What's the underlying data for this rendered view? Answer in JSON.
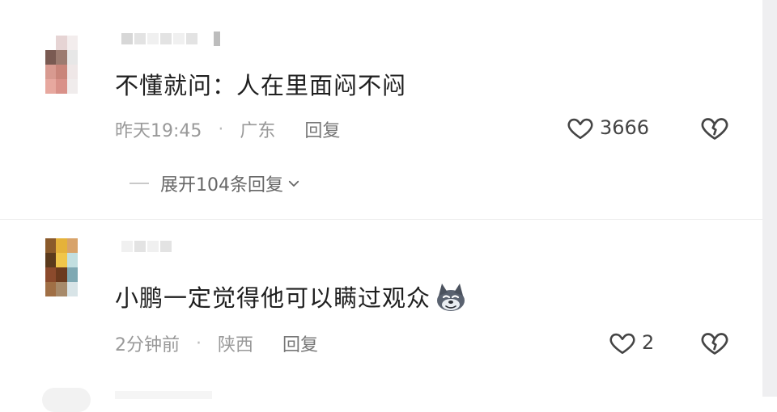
{
  "comments": [
    {
      "text": "不懂就问：人在里面闷不闷",
      "time": "昨天19:45",
      "location": "广东",
      "reply_label": "回复",
      "like_count": "3666",
      "expand_label": "展开104条回复",
      "avatar_colors": [
        "#ffffff",
        "#e6d4d4",
        "#f3eded",
        "#7a5a52",
        "#9c7b70",
        "#e7e7e7",
        "#d89a90",
        "#c9857a",
        "#efe7e7",
        "#e7a89f",
        "#d99189",
        "#f0ecec"
      ]
    },
    {
      "text": "小鹏一定觉得他可以瞒过观众",
      "time": "2分钟前",
      "location": "陕西",
      "reply_label": "回复",
      "like_count": "2",
      "avatar_colors": [
        "#8a5a2b",
        "#e5b23a",
        "#d8a36a",
        "#5b3a1c",
        "#f0c64a",
        "#c2dfe0",
        "#8b4a2c",
        "#6b3a1e",
        "#7fa9b3",
        "#a06f45",
        "#a78a6a",
        "#d8e4e7"
      ]
    }
  ],
  "icons": {
    "like": "heart-outline-icon",
    "dislike": "broken-heart-icon",
    "expand": "chevron-down-icon",
    "emoji": "wolf-emoji-icon"
  },
  "colors": {
    "text": "#1f1f1f",
    "meta": "#999999",
    "icon": "#444444"
  }
}
